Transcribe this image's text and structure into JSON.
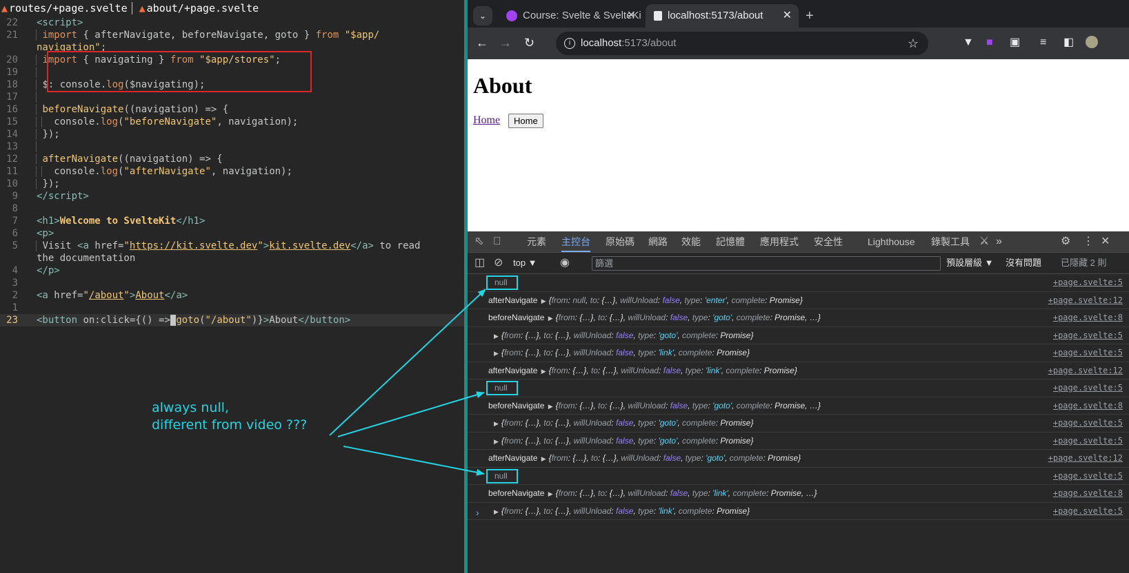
{
  "editor": {
    "tabs": [
      "routes/+page.svelte",
      "about/+page.svelte"
    ],
    "tab_suffix": ""
  },
  "browser": {
    "tabs": [
      {
        "title": "Course: Svelte & SvelteKi"
      },
      {
        "title": "localhost:5173/about"
      }
    ],
    "url_host": "localhost",
    "url_path": ":5173/about",
    "page": {
      "heading": "About",
      "link": "Home",
      "button": "Home"
    }
  },
  "devtools": {
    "tabs": [
      "元素",
      "主控台",
      "原始碼",
      "網路",
      "效能",
      "記憶體",
      "應用程式",
      "安全性",
      "Lighthouse",
      "錄製工具"
    ],
    "context": "top ▼",
    "filter_placeholder": "篩選",
    "levels": "預設層級 ▼",
    "issues": "沒有問題",
    "hidden": "已隱藏 2 則",
    "rows": [
      {
        "type": "null",
        "text": "null",
        "src": "+page.svelte:5"
      },
      {
        "type": "obj",
        "label": "afterNavigate",
        "from": "null",
        "to": "{…}",
        "willUnload": "false",
        "typeval": "'enter'",
        "extra": "",
        "src": "+page.svelte:12"
      },
      {
        "type": "obj",
        "label": "beforeNavigate",
        "from": "{…}",
        "to": "{…}",
        "willUnload": "false",
        "typeval": "'goto'",
        "extra": ", …",
        "src": "+page.svelte:8"
      },
      {
        "type": "obj",
        "label": "",
        "from": "{…}",
        "to": "{…}",
        "willUnload": "false",
        "typeval": "'goto'",
        "extra": "",
        "src": "+page.svelte:5"
      },
      {
        "type": "obj",
        "label": "",
        "from": "{…}",
        "to": "{…}",
        "willUnload": "false",
        "typeval": "'link'",
        "extra": "",
        "src": "+page.svelte:5"
      },
      {
        "type": "obj",
        "label": "afterNavigate",
        "from": "{…}",
        "to": "{…}",
        "willUnload": "false",
        "typeval": "'link'",
        "extra": "",
        "src": "+page.svelte:12"
      },
      {
        "type": "null",
        "text": "null",
        "src": "+page.svelte:5"
      },
      {
        "type": "obj",
        "label": "beforeNavigate",
        "from": "{…}",
        "to": "{…}",
        "willUnload": "false",
        "typeval": "'goto'",
        "extra": ", …",
        "src": "+page.svelte:8"
      },
      {
        "type": "obj",
        "label": "",
        "from": "{…}",
        "to": "{…}",
        "willUnload": "false",
        "typeval": "'goto'",
        "extra": "",
        "src": "+page.svelte:5"
      },
      {
        "type": "obj",
        "label": "",
        "from": "{…}",
        "to": "{…}",
        "willUnload": "false",
        "typeval": "'goto'",
        "extra": "",
        "src": "+page.svelte:5"
      },
      {
        "type": "obj",
        "label": "afterNavigate",
        "from": "{…}",
        "to": "{…}",
        "willUnload": "false",
        "typeval": "'goto'",
        "extra": "",
        "src": "+page.svelte:12"
      },
      {
        "type": "null",
        "text": "null",
        "src": "+page.svelte:5"
      },
      {
        "type": "obj",
        "label": "beforeNavigate",
        "from": "{…}",
        "to": "{…}",
        "willUnload": "false",
        "typeval": "'link'",
        "extra": ", …",
        "src": "+page.svelte:8"
      },
      {
        "type": "obj",
        "label": "",
        "from": "{…}",
        "to": "{…}",
        "willUnload": "false",
        "typeval": "'link'",
        "extra": "",
        "src": "+page.svelte:5"
      }
    ]
  },
  "annotation": {
    "line1": "always null,",
    "line2": "different from video ???"
  },
  "colors": {
    "annotation": "#22d4e4",
    "highlight_box": "#e0242a",
    "accent": "#7cacf8"
  }
}
